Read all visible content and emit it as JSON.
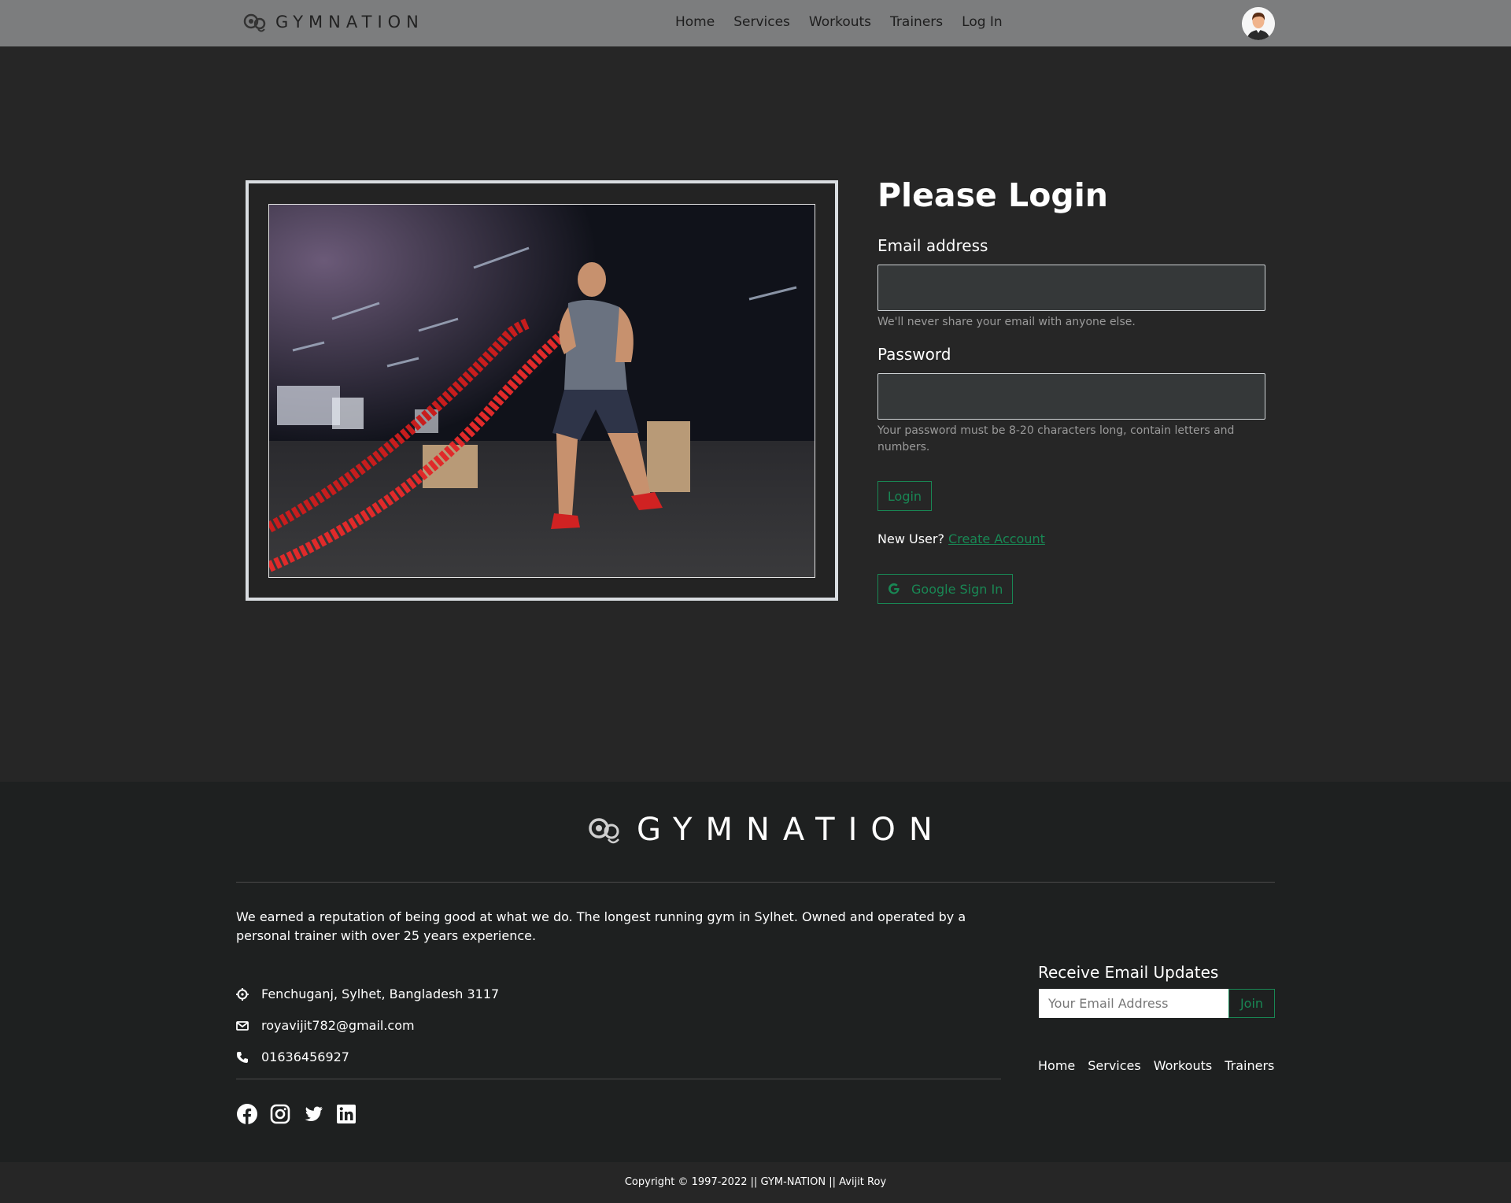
{
  "navbar": {
    "logo_text": "GYMNATION",
    "links": [
      "Home",
      "Services",
      "Workouts",
      "Trainers",
      "Log In"
    ]
  },
  "login": {
    "title": "Please Login",
    "email_label": "Email address",
    "email_value": "",
    "email_help": "We'll never share your email with anyone else.",
    "password_label": "Password",
    "password_value": "",
    "password_help": "Your password must be 8-20 characters long, contain letters and numbers.",
    "login_button": "Login",
    "new_user_text": "New User?",
    "create_account_link": "Create Account",
    "google_button": "Google Sign In"
  },
  "footer": {
    "logo_text": "GYMNATION",
    "about": "We earned a reputation of being good at what we do. The longest running gym in Sylhet. Owned and operated by a personal trainer with over 25 years experience.",
    "address": "Fenchuganj, Sylhet, Bangladesh 3117",
    "email": "royavijit782@gmail.com",
    "phone": "01636456927",
    "updates_title": "Receive Email Updates",
    "updates_placeholder": "Your Email Address",
    "join_button": "Join",
    "links": [
      "Home",
      "Services",
      "Workouts",
      "Trainers"
    ],
    "socials": [
      "facebook-icon",
      "instagram-icon",
      "twitter-icon",
      "linkedin-icon"
    ]
  },
  "copyright": "Copyright © 1997-2022 || GYM-NATION || Avijit Roy",
  "colors": {
    "accent": "#198754",
    "navbar_bg": "#7c7d7e",
    "page_bg": "#262626",
    "footer_bg": "#1e2020"
  }
}
